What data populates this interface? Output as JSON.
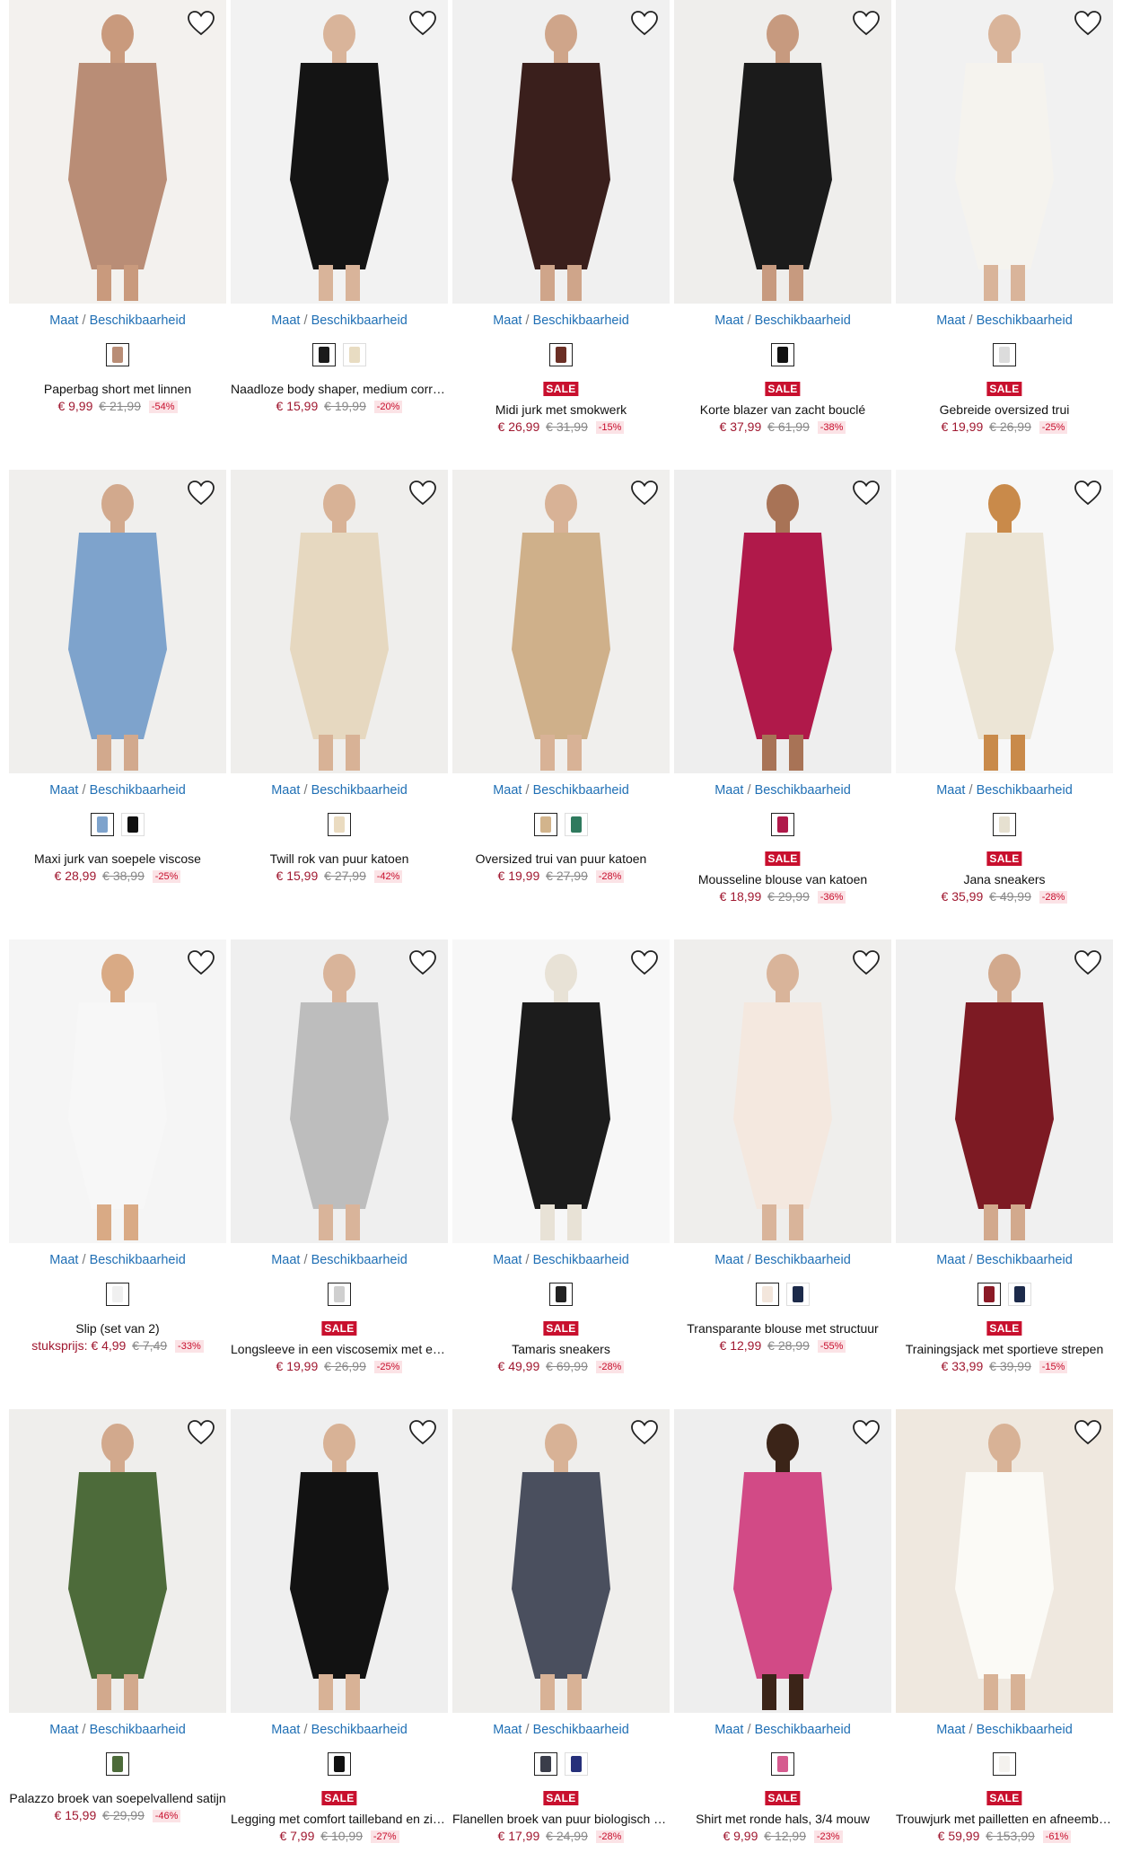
{
  "availability_label": {
    "size": "Maat",
    "separator": " / ",
    "stock": "Beschikbaarheid"
  },
  "sale_label": "SALE",
  "products": [
    {
      "name": "Paperbag short met linnen",
      "price": "€ 9,99",
      "old_price": "€ 21,99",
      "discount": "-54%",
      "sale": false,
      "colors": [
        "#b98d76"
      ],
      "image_bg": "#f3f1ee",
      "garment": "#b98d76",
      "skin": "#c99a7d"
    },
    {
      "name": "Naadloze body shaper, medium correctie",
      "price": "€ 15,99",
      "old_price": "€ 19,99",
      "discount": "-20%",
      "sale": false,
      "colors": [
        "#1a1a1a",
        "#e8dcc2"
      ],
      "image_bg": "#f2f2f2",
      "garment": "#141414",
      "skin": "#d9b49a"
    },
    {
      "name": "Midi jurk met smokwerk",
      "price": "€ 26,99",
      "old_price": "€ 31,99",
      "discount": "-15%",
      "sale": true,
      "colors": [
        "#6b2f25"
      ],
      "image_bg": "#f0f0f0",
      "garment": "#3a1f1c",
      "skin": "#cfa58a"
    },
    {
      "name": "Korte blazer van zacht bouclé",
      "price": "€ 37,99",
      "old_price": "€ 61,99",
      "discount": "-38%",
      "sale": true,
      "colors": [
        "#111111"
      ],
      "image_bg": "#efeeec",
      "garment": "#1b1b1b",
      "skin": "#c79a7f"
    },
    {
      "name": "Gebreide oversized trui",
      "price": "€ 19,99",
      "old_price": "€ 26,99",
      "discount": "-25%",
      "sale": true,
      "colors": [
        "#dcdcdc"
      ],
      "image_bg": "#f1f1f1",
      "garment": "#f5f3ee",
      "skin": "#d9b49a"
    },
    {
      "name": "Maxi jurk van soepele viscose",
      "price": "€ 28,99",
      "old_price": "€ 38,99",
      "discount": "-25%",
      "sale": false,
      "colors": [
        "#7ea3cc",
        "#111111"
      ],
      "image_bg": "#f0efed",
      "garment": "#7ea3cc",
      "skin": "#d2a98d"
    },
    {
      "name": "Twill rok van puur katoen",
      "price": "€ 15,99",
      "old_price": "€ 27,99",
      "discount": "-42%",
      "sale": false,
      "colors": [
        "#eadbc0"
      ],
      "image_bg": "#efeeec",
      "garment": "#e6d8c0",
      "skin": "#d8b296"
    },
    {
      "name": "Oversized trui van puur katoen",
      "price": "€ 19,99",
      "old_price": "€ 27,99",
      "discount": "-28%",
      "sale": false,
      "colors": [
        "#d2b48c",
        "#2f7a5e"
      ],
      "image_bg": "#f0efed",
      "garment": "#cfb08a",
      "skin": "#d8b296"
    },
    {
      "name": "Mousseline blouse van katoen",
      "price": "€ 18,99",
      "old_price": "€ 29,99",
      "discount": "-36%",
      "sale": true,
      "colors": [
        "#b0194a"
      ],
      "image_bg": "#eeeeee",
      "garment": "#b0194a",
      "skin": "#a87356"
    },
    {
      "name": "Jana sneakers",
      "price": "€ 35,99",
      "old_price": "€ 49,99",
      "discount": "-28%",
      "sale": true,
      "colors": [
        "#e6e0d0"
      ],
      "image_bg": "#f7f7f7",
      "garment": "#ece5d6",
      "skin": "#c98a4a"
    },
    {
      "name": "Slip (set van 2)",
      "unit_label": "stuksprijs:",
      "price": "€ 4,99",
      "old_price": "€ 7,49",
      "discount": "-33%",
      "sale": false,
      "colors": [
        "#f0f0f0"
      ],
      "image_bg": "#f5f5f5",
      "garment": "#f7f7f7",
      "skin": "#d9aa85"
    },
    {
      "name": "Longsleeve in een viscosemix met elastaan",
      "price": "€ 19,99",
      "old_price": "€ 26,99",
      "discount": "-25%",
      "sale": true,
      "colors": [
        "#cfcfcf"
      ],
      "image_bg": "#efefef",
      "garment": "#bdbdbd",
      "skin": "#d9b49a"
    },
    {
      "name": "Tamaris sneakers",
      "price": "€ 49,99",
      "old_price": "€ 69,99",
      "discount": "-28%",
      "sale": true,
      "colors": [
        "#222222"
      ],
      "image_bg": "#f7f7f7",
      "garment": "#1c1c1c",
      "skin": "#e8e2d6"
    },
    {
      "name": "Transparante blouse met structuur",
      "price": "€ 12,99",
      "old_price": "€ 28,99",
      "discount": "-55%",
      "sale": false,
      "colors": [
        "#f3e6dc",
        "#1c2a4a"
      ],
      "image_bg": "#efeeec",
      "garment": "#f4e8df",
      "skin": "#d9b49a"
    },
    {
      "name": "Trainingsjack met sportieve strepen",
      "price": "€ 33,99",
      "old_price": "€ 39,99",
      "discount": "-15%",
      "sale": true,
      "colors": [
        "#8b1a26",
        "#1c2a4a"
      ],
      "image_bg": "#f0f0f0",
      "garment": "#7d1a23",
      "skin": "#d2a98d"
    },
    {
      "name": "Palazzo broek van soepelvallend satijn",
      "price": "€ 15,99",
      "old_price": "€ 29,99",
      "discount": "-46%",
      "sale": false,
      "colors": [
        "#4d6b3a"
      ],
      "image_bg": "#efeeec",
      "garment": "#4d6b3a",
      "skin": "#d2a98d"
    },
    {
      "name": "Legging met comfort tailleband en zijdelingse details",
      "price": "€ 7,99",
      "old_price": "€ 10,99",
      "discount": "-27%",
      "sale": true,
      "colors": [
        "#111111"
      ],
      "image_bg": "#efefef",
      "garment": "#121212",
      "skin": "#d8b296"
    },
    {
      "name": "Flanellen broek van puur biologisch katoen",
      "price": "€ 17,99",
      "old_price": "€ 24,99",
      "discount": "-28%",
      "sale": true,
      "colors": [
        "#3a3d4a",
        "#26307a"
      ],
      "image_bg": "#efeeec",
      "garment": "#4a4f5e",
      "skin": "#d8b296"
    },
    {
      "name": "Shirt met ronde hals, 3/4 mouw",
      "price": "€ 9,99",
      "old_price": "€ 12,99",
      "discount": "-23%",
      "sale": true,
      "colors": [
        "#d65b8f"
      ],
      "image_bg": "#eeeeee",
      "garment": "#d24a86",
      "skin": "#3b2418"
    },
    {
      "name": "Trouwjurk met pailletten en afneembare rok",
      "price": "€ 59,99",
      "old_price": "€ 153,99",
      "discount": "-61%",
      "sale": true,
      "colors": [
        "#f4f2ee"
      ],
      "image_bg": "#efe8df",
      "garment": "#fbfaf6",
      "skin": "#d8b296"
    }
  ]
}
